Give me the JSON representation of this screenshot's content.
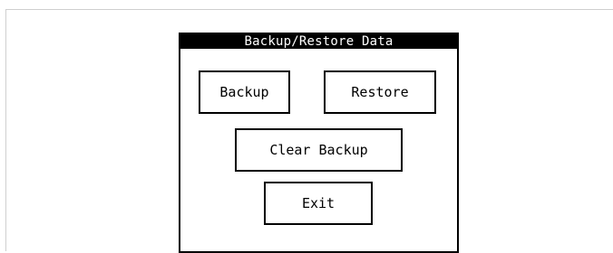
{
  "dialog": {
    "title": "Backup/Restore Data",
    "buttons": {
      "backup": "Backup",
      "restore": "Restore",
      "clear_backup": "Clear Backup",
      "exit": "Exit"
    }
  },
  "colors": {
    "background": "#ffffff",
    "title_bar": "#000000",
    "title_text": "#ffffff",
    "border": "#000000",
    "outer_frame": "#cfcfcf"
  }
}
